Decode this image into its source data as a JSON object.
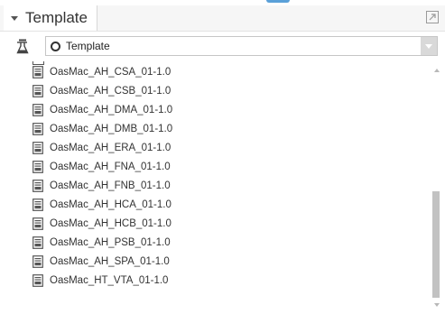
{
  "panel": {
    "title": "Template",
    "expand_icon": "expand-arrow-icon"
  },
  "toolbar": {
    "filter_icon": "filter-flask-icon",
    "select": {
      "value": "Template",
      "icon": "circle-icon"
    }
  },
  "list": {
    "item_icon": "document-icon",
    "items": [
      "OasMac_AH_CSA_01-1.0",
      "OasMac_AH_CSB_01-1.0",
      "OasMac_AH_DMA_01-1.0",
      "OasMac_AH_DMB_01-1.0",
      "OasMac_AH_ERA_01-1.0",
      "OasMac_AH_FNA_01-1.0",
      "OasMac_AH_FNB_01-1.0",
      "OasMac_AH_HCA_01-1.0",
      "OasMac_AH_HCB_01-1.0",
      "OasMac_AH_PSB_01-1.0",
      "OasMac_AH_SPA_01-1.0",
      "OasMac_HT_VTA_01-1.0"
    ]
  },
  "colors": {
    "accent": "#5aa0d8",
    "scroll_thumb": "#c2c2c2"
  }
}
